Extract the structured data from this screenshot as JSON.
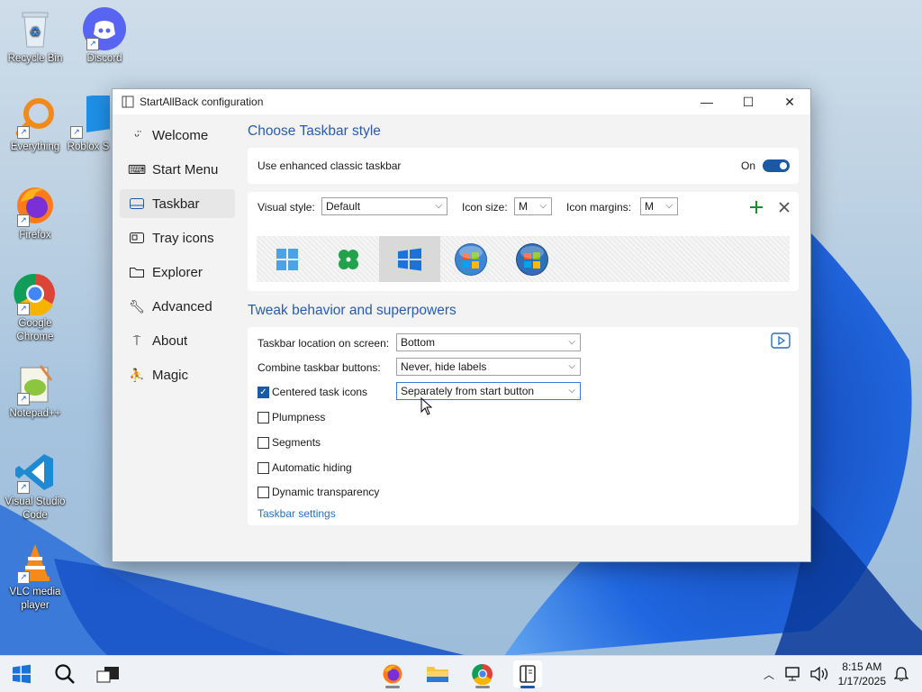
{
  "desktop": {
    "icons": [
      {
        "label": "Recycle Bin"
      },
      {
        "label": "Discord"
      },
      {
        "label": "Everything"
      },
      {
        "label": "Roblox S"
      },
      {
        "label": "Firefox"
      },
      {
        "label": "Google Chrome"
      },
      {
        "label": "Notepad++"
      },
      {
        "label": "Visual Studio Code"
      },
      {
        "label": "VLC media player"
      }
    ]
  },
  "window": {
    "title": "StartAllBack configuration",
    "controls": {
      "minimize": "—",
      "maximize": "☐",
      "close": "✕"
    }
  },
  "sidebar": {
    "items": [
      {
        "label": "Welcome",
        "icon": "smile-icon"
      },
      {
        "label": "Start Menu",
        "icon": "keyboard-icon"
      },
      {
        "label": "Taskbar",
        "icon": "taskbar-icon",
        "active": true
      },
      {
        "label": "Tray icons",
        "icon": "tray-icon"
      },
      {
        "label": "Explorer",
        "icon": "folder-icon"
      },
      {
        "label": "Advanced",
        "icon": "wrench-icon"
      },
      {
        "label": "About",
        "icon": "info-icon"
      },
      {
        "label": "Magic",
        "icon": "magic-icon"
      }
    ]
  },
  "section1": {
    "title": "Choose Taskbar style",
    "enhanced_label": "Use enhanced classic taskbar",
    "enhanced_state": "On",
    "visual_style_label": "Visual style:",
    "visual_style_value": "Default",
    "icon_size_label": "Icon size:",
    "icon_size_value": "M",
    "icon_margins_label": "Icon margins:",
    "icon_margins_value": "M",
    "styles": [
      "Windows 11 style",
      "Clover style",
      "Windows 10 style",
      "Windows 7 orb",
      "Windows Vista orb"
    ],
    "selected_style_index": 2
  },
  "section2": {
    "title": "Tweak behavior and superpowers",
    "location_label": "Taskbar location on screen:",
    "location_value": "Bottom",
    "combine_label": "Combine taskbar buttons:",
    "combine_value": "Never, hide labels",
    "centered_label": "Centered task icons",
    "centered_checked": true,
    "centered_value": "Separately from start button",
    "plumpness_label": "Plumpness",
    "segments_label": "Segments",
    "autohide_label": "Automatic hiding",
    "dyntrans_label": "Dynamic transparency",
    "settings_link": "Taskbar settings"
  },
  "taskbar": {
    "time": "8:15 AM",
    "date": "1/17/2025"
  },
  "colors": {
    "accent": "#1b5aa3",
    "heading": "#2a5caa",
    "add": "#1e8a2e"
  }
}
